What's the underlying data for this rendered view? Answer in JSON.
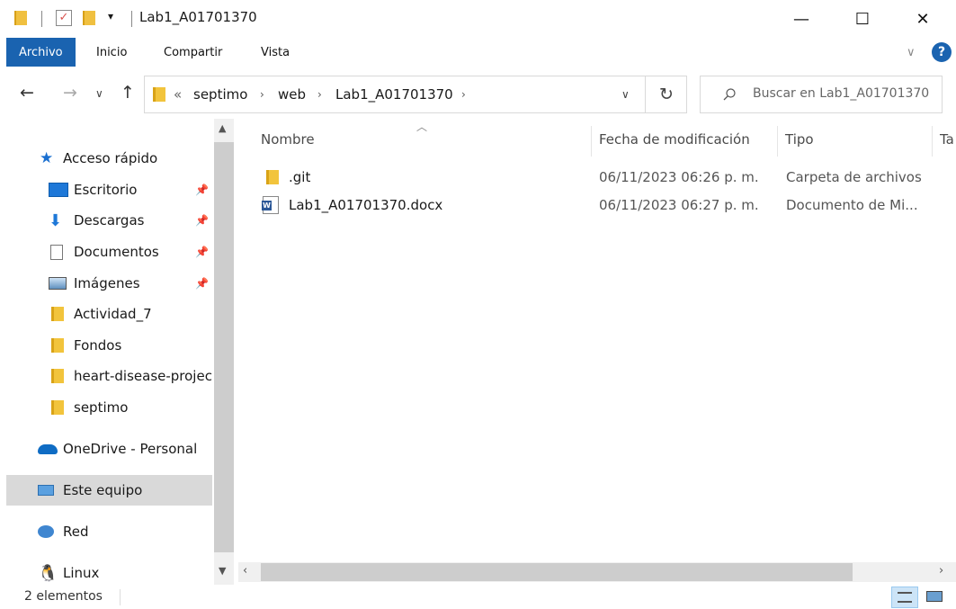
{
  "window": {
    "title": "Lab1_A01701370",
    "qat_dropdown": "▾",
    "buttons": {
      "minimize": "—",
      "maximize": "☐",
      "close": "✕"
    }
  },
  "ribbon": {
    "tabs": [
      "Archivo",
      "Inicio",
      "Compartir",
      "Vista"
    ],
    "expand_chevron": "∨",
    "help": "?"
  },
  "nav": {
    "back": "←",
    "forward": "→",
    "recent": "∨",
    "up": "↑",
    "overflow": "«",
    "breadcrumbs": [
      "septimo",
      "web",
      "Lab1_A01701370"
    ],
    "dropdown": "∨",
    "refresh": "↻"
  },
  "search": {
    "placeholder": "Buscar en Lab1_A01701370"
  },
  "sidebar": {
    "items": [
      {
        "label": "Acceso rápido",
        "icon": "star-icon"
      },
      {
        "label": "Escritorio",
        "icon": "desktop-icon",
        "pinned": true
      },
      {
        "label": "Descargas",
        "icon": "download-icon",
        "pinned": true
      },
      {
        "label": "Documentos",
        "icon": "document-icon",
        "pinned": true
      },
      {
        "label": "Imágenes",
        "icon": "pictures-icon",
        "pinned": true
      },
      {
        "label": "Actividad_7",
        "icon": "folder-icon"
      },
      {
        "label": "Fondos",
        "icon": "folder-icon"
      },
      {
        "label": "heart-disease-projec",
        "icon": "folder-icon"
      },
      {
        "label": "septimo",
        "icon": "folder-icon"
      },
      {
        "label": "OneDrive - Personal",
        "icon": "cloud-icon"
      },
      {
        "label": "Este equipo",
        "icon": "computer-icon",
        "selected": true
      },
      {
        "label": "Red",
        "icon": "network-icon"
      },
      {
        "label": "Linux",
        "icon": "linux-icon"
      }
    ],
    "pin_glyph": "📌"
  },
  "columns": {
    "name": "Nombre",
    "date": "Fecha de modificación",
    "type": "Tipo",
    "size": "Ta"
  },
  "files": [
    {
      "name": ".git",
      "date": "06/11/2023 06:26 p. m.",
      "type": "Carpeta de archivos",
      "icon": "folder-icon"
    },
    {
      "name": "Lab1_A01701370.docx",
      "date": "06/11/2023 06:27 p. m.",
      "type": "Documento de Mi...",
      "icon": "word-doc-icon"
    }
  ],
  "status": {
    "count": "2 elementos"
  },
  "colors": {
    "accent": "#1a63b0",
    "folder": "#f2c43c",
    "selected": "#d9d9d9"
  }
}
